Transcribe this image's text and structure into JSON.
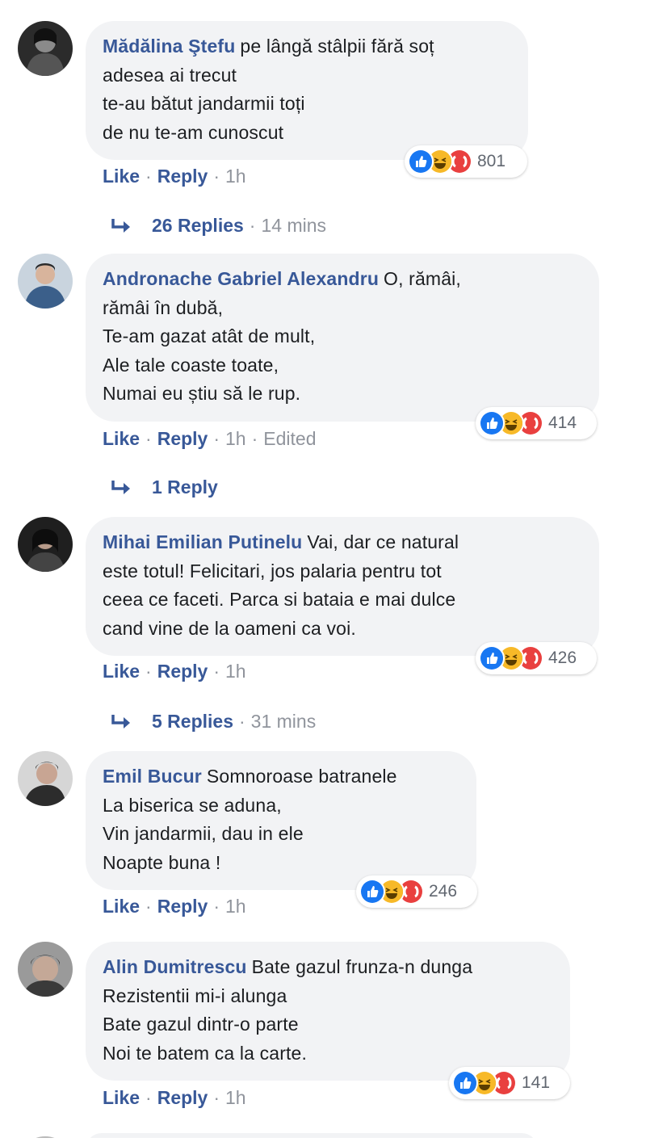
{
  "colors": {
    "author": "#385898",
    "bubble": "#f2f3f5",
    "meta": "#90949c",
    "like_blue": "#1877f2",
    "haha_yellow": "#f7b928",
    "angry_red": "#e9403f"
  },
  "comments": [
    {
      "author": "Mădălina Ştefu",
      "lines": [
        "pe lângă stâlpii fără soț",
        "adesea ai trecut",
        "te-au bătut jandarmii toți",
        "de nu te-am cunoscut"
      ],
      "reaction_icons": [
        "like-icon",
        "haha-icon",
        "angry-icon"
      ],
      "reaction_count": "801",
      "like": "Like",
      "reply": "Reply",
      "time": "1h",
      "edited": "",
      "replies": {
        "label": "26 Replies",
        "time": "14 mins"
      }
    },
    {
      "author": "Andronache Gabriel Alexandru",
      "lines": [
        "O, rămâi,",
        "rămâi în dubă,",
        "Te-am gazat atât de mult,",
        "Ale tale coaste toate,",
        "Numai eu știu să le rup."
      ],
      "reaction_icons": [
        "like-icon",
        "haha-icon",
        "angry-icon"
      ],
      "reaction_count": "414",
      "like": "Like",
      "reply": "Reply",
      "time": "1h",
      "edited": "Edited",
      "replies": {
        "label": "1 Reply",
        "time": ""
      }
    },
    {
      "author": "Mihai Emilian Putinelu",
      "lines": [
        "Vai, dar ce natural",
        "este totul! Felicitari, jos palaria pentru tot",
        "ceea ce faceti. Parca si bataia e mai dulce",
        "cand vine de la oameni ca voi."
      ],
      "reaction_icons": [
        "like-icon",
        "haha-icon",
        "angry-icon"
      ],
      "reaction_count": "426",
      "like": "Like",
      "reply": "Reply",
      "time": "1h",
      "edited": "",
      "replies": {
        "label": "5 Replies",
        "time": "31 mins"
      }
    },
    {
      "author": "Emil Bucur",
      "lines": [
        "Somnoroase batranele",
        "La biserica se aduna,",
        "Vin jandarmii, dau in ele",
        "Noapte buna !"
      ],
      "reaction_icons": [
        "like-icon",
        "haha-icon",
        "angry-icon"
      ],
      "reaction_count": "246",
      "like": "Like",
      "reply": "Reply",
      "time": "1h",
      "edited": "",
      "replies": null
    },
    {
      "author": "Alin Dumitrescu",
      "lines": [
        "Bate gazul frunza-n dunga",
        "Rezistentii mi-i alunga",
        "Bate gazul dintr-o parte",
        "Noi te batem ca la carte."
      ],
      "reaction_icons": [
        "like-icon",
        "haha-icon",
        "angry-icon"
      ],
      "reaction_count": "141",
      "like": "Like",
      "reply": "Reply",
      "time": "1h",
      "edited": "",
      "replies": null
    }
  ]
}
